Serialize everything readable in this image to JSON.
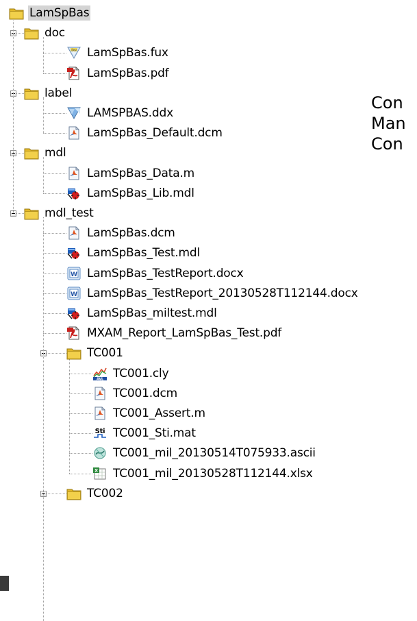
{
  "tree": {
    "root": {
      "label": "LamSpBas",
      "icon": "folder-icon"
    },
    "rows": [
      {
        "id": "doc",
        "label": "doc",
        "icon": "folder-icon",
        "level": 1,
        "expanded": true
      },
      {
        "id": "lamspbas-fux",
        "label": "LamSpBas.fux",
        "icon": "fux-file-icon",
        "level": 2
      },
      {
        "id": "lamspbas-pdf",
        "label": "LamSpBas.pdf",
        "icon": "pdf-file-icon",
        "level": 2
      },
      {
        "id": "label",
        "label": "label",
        "icon": "folder-icon",
        "level": 1,
        "expanded": true
      },
      {
        "id": "lamspbas-ddx",
        "label": "LAMSPBAS.ddx",
        "icon": "ddx-file-icon",
        "level": 2
      },
      {
        "id": "lamspbas-default-dcm",
        "label": "LamSpBas_Default.dcm",
        "icon": "matlab-file-icon",
        "level": 2
      },
      {
        "id": "mdl",
        "label": "mdl",
        "icon": "folder-icon",
        "level": 1,
        "expanded": true
      },
      {
        "id": "lamspbas-data-m",
        "label": "LamSpBas_Data.m",
        "icon": "matlab-file-icon",
        "level": 2
      },
      {
        "id": "lamspbas-lib-mdl",
        "label": "LamSpBas_Lib.mdl",
        "icon": "simulink-model-icon",
        "level": 2
      },
      {
        "id": "mdl-test",
        "label": "mdl_test",
        "icon": "folder-icon",
        "level": 1,
        "expanded": true
      },
      {
        "id": "lamspbas-dcm",
        "label": "LamSpBas.dcm",
        "icon": "matlab-file-icon",
        "level": 2
      },
      {
        "id": "lamspbas-test-mdl",
        "label": "LamSpBas_Test.mdl",
        "icon": "simulink-model-icon",
        "level": 2
      },
      {
        "id": "lamspbas-testreport-docx",
        "label": "LamSpBas_TestReport.docx",
        "icon": "word-document-icon",
        "level": 2
      },
      {
        "id": "lamspbas-testreport-2013-docx",
        "label": "LamSpBas_TestReport_20130528T112144.docx",
        "icon": "word-document-icon",
        "level": 2
      },
      {
        "id": "lamspbas-miltest-mdl",
        "label": "LamSpBas_miltest.mdl",
        "icon": "simulink-model-icon",
        "level": 2
      },
      {
        "id": "mxam-report-pdf",
        "label": "MXAM_Report_LamSpBas_Test.pdf",
        "icon": "pdf-file-icon",
        "level": 2
      },
      {
        "id": "tc001",
        "label": "TC001",
        "icon": "folder-icon",
        "level": 2,
        "expanded": true
      },
      {
        "id": "tc001-cly",
        "label": "TC001.cly",
        "icon": "avl-file-icon",
        "level": 3
      },
      {
        "id": "tc001-dcm",
        "label": "TC001.dcm",
        "icon": "matlab-file-icon",
        "level": 3
      },
      {
        "id": "tc001-assert-m",
        "label": "TC001_Assert.m",
        "icon": "matlab-file-icon",
        "level": 3
      },
      {
        "id": "tc001-sti-mat",
        "label": "TC001_Sti.mat",
        "icon": "sti-file-icon",
        "level": 3
      },
      {
        "id": "tc001-mil-ascii",
        "label": "TC001_mil_20130514T075933.ascii",
        "icon": "ascii-file-icon",
        "level": 3
      },
      {
        "id": "tc001-mil-xlsx",
        "label": "TC001_mil_20130528T112144.xlsx",
        "icon": "excel-file-icon",
        "level": 3
      },
      {
        "id": "tc002",
        "label": "TC002",
        "icon": "folder-icon",
        "level": 2,
        "expanded": true
      }
    ]
  },
  "side_text": [
    "Con",
    "Man",
    "Con"
  ],
  "colors": {
    "folder": "#f2d04b",
    "selection": "#d4d4d4",
    "pdf_red": "#c8211e",
    "sim_red": "#d21e1e",
    "sim_blue": "#1b5bb8"
  }
}
